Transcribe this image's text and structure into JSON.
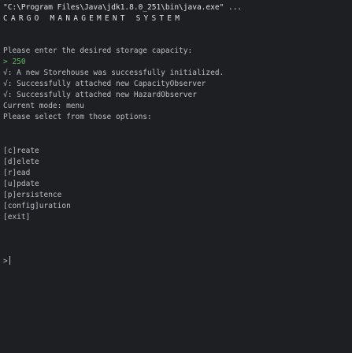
{
  "console": {
    "command": "\"C:\\Program Files\\Java\\jdk1.8.0_251\\bin\\java.exe\" ...",
    "banner": "CARGO MANAGEMENT SYSTEM",
    "lines": [
      "Please enter the desired storage capacity:",
      "> 250",
      "√: A new Storehouse was successfully initialized.",
      "√: Successfully attached new CapacityObserver",
      "√: Successfully attached new HazardObserver",
      "Current mode: menu",
      "Please select from those options:"
    ],
    "menu_items": [
      "[c]reate",
      "[d]elete",
      "[r]ead",
      "[u]pdate",
      "[p]ersistence",
      "[config]uration",
      "[exit]"
    ],
    "input_prompt": ">"
  }
}
